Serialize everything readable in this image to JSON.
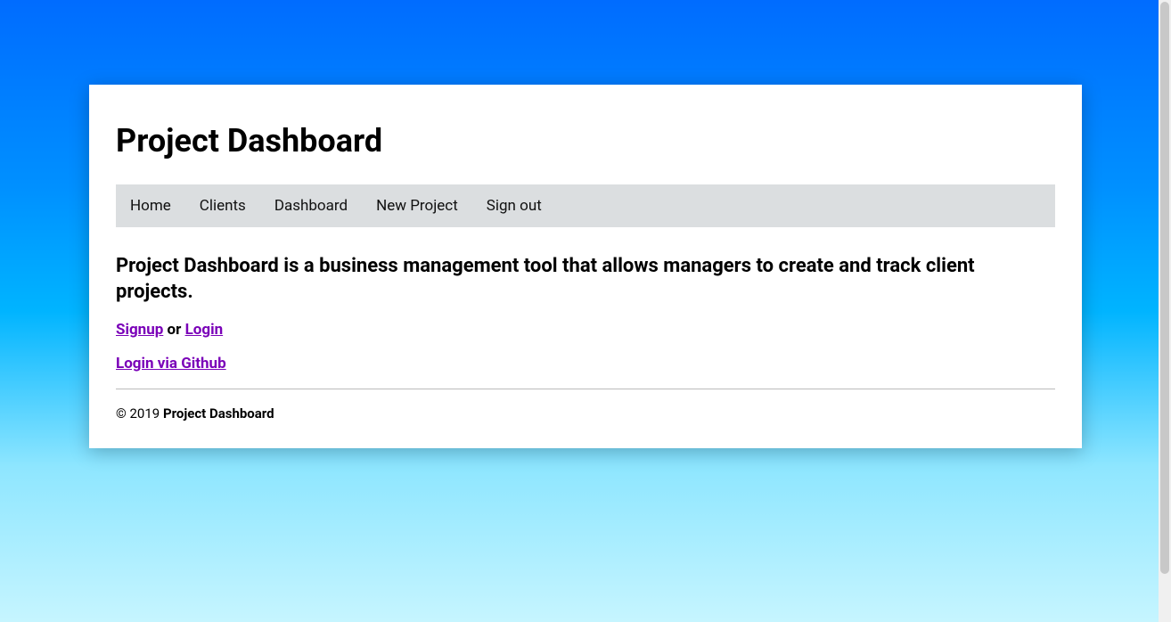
{
  "header": {
    "title": "Project Dashboard"
  },
  "nav": {
    "items": [
      {
        "label": "Home"
      },
      {
        "label": "Clients"
      },
      {
        "label": "Dashboard"
      },
      {
        "label": "New Project"
      },
      {
        "label": "Sign out"
      }
    ]
  },
  "main": {
    "description": "Project Dashboard is a business management tool that allows managers to create and track client projects.",
    "signup_label": "Signup",
    "or_text": " or ",
    "login_label": "Login",
    "github_login_label": "Login via Github"
  },
  "footer": {
    "copyright_prefix": "© 2019 ",
    "brand": "Project Dashboard"
  }
}
